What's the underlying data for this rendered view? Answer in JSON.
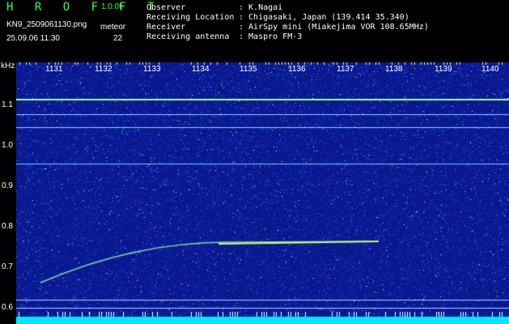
{
  "header": {
    "title": "H R O F F T",
    "version": "1.0.0f",
    "filename": "KN9_2509061130.png",
    "datetime": "25.09.06 11:30",
    "meteor_label": "meteor",
    "meteor_count": "22"
  },
  "meta": [
    {
      "key": "Observer",
      "value": ": K.Nagai"
    },
    {
      "key": "Receiving Location",
      "value": ": Chigasaki, Japan (139.414 35.340)"
    },
    {
      "key": "Receiver",
      "value": ": AirSpy mini (Miakejima VOR 108.65MHz)"
    },
    {
      "key": "Receiving antenna",
      "value": ": Maspro FM-3"
    }
  ],
  "axes": {
    "y_unit": "kHz",
    "y_ticks": [
      "1.1",
      "1.0",
      "0.9",
      "0.8",
      "0.7",
      "0.6"
    ],
    "x_ticks": [
      "1131",
      "1132",
      "1133",
      "1134",
      "1135",
      "1136",
      "1137",
      "1138",
      "1139",
      "1140"
    ]
  },
  "colors": {
    "background": "#000000",
    "noise_base": "#0a1890",
    "signal": "#9cff9c",
    "bottom_band": "#00e8ff",
    "title_green": "#3cff3c"
  }
}
